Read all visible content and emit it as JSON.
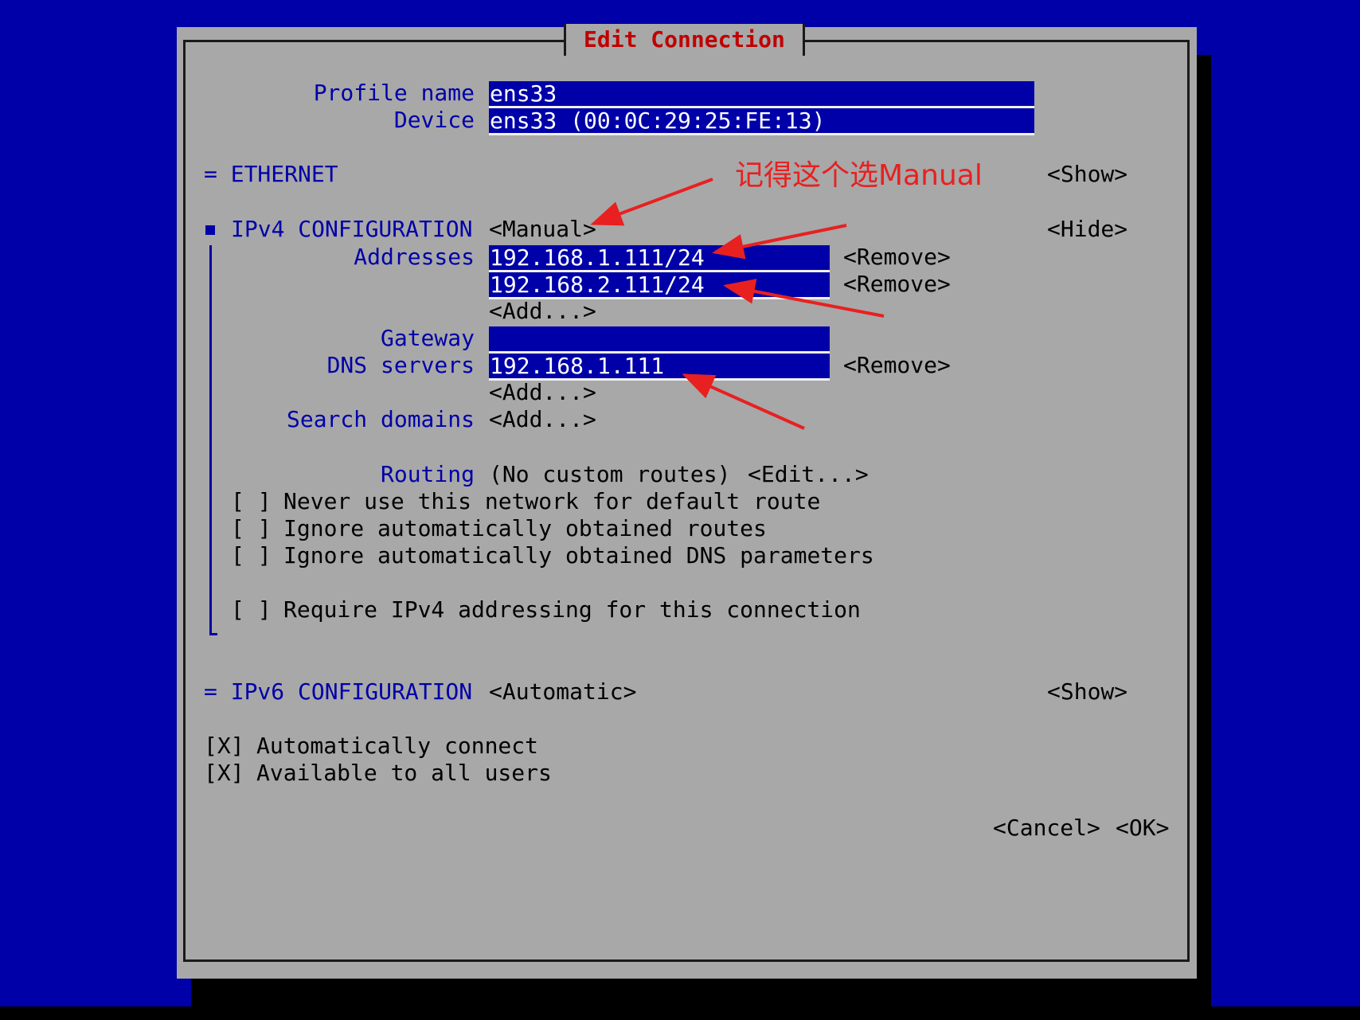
{
  "dialog": {
    "title": "Edit Connection",
    "profile_label": "Profile name",
    "profile_value": "ens33",
    "device_label": "Device",
    "device_value": "ens33 (00:0C:29:25:FE:13)",
    "ethernet_label": "= ETHERNET",
    "ethernet_toggle": "<Show>",
    "ipv4": {
      "label": "IPv4 CONFIGURATION",
      "mode": "<Manual>",
      "toggle": "<Hide>",
      "addresses_label": "Addresses",
      "addresses": [
        "192.168.1.111/24",
        "192.168.2.111/24"
      ],
      "remove_label": "<Remove>",
      "add_label": "<Add...>",
      "gateway_label": "Gateway",
      "gateway_value": "",
      "dns_label": "DNS servers",
      "dns_value": "192.168.1.111",
      "search_label": "Search domains",
      "routing_label": "Routing",
      "routing_value": "(No custom routes)",
      "edit_label": "<Edit...>",
      "checkbox_unchecked": "[ ]",
      "never_default_route": "Never use this network for default route",
      "ignore_routes": "Ignore automatically obtained routes",
      "ignore_dns": "Ignore automatically obtained DNS parameters",
      "require_ipv4": "Require IPv4 addressing for this connection"
    },
    "ipv6": {
      "label": "= IPv6 CONFIGURATION",
      "mode": "<Automatic>",
      "toggle": "<Show>"
    },
    "checkbox_checked": "[X]",
    "auto_connect": "Automatically connect",
    "all_users": "Available to all users",
    "cancel_label": "<Cancel>",
    "ok_label": "<OK>"
  },
  "annotation": {
    "text": "记得这个选Manual",
    "color": "#e82020"
  }
}
